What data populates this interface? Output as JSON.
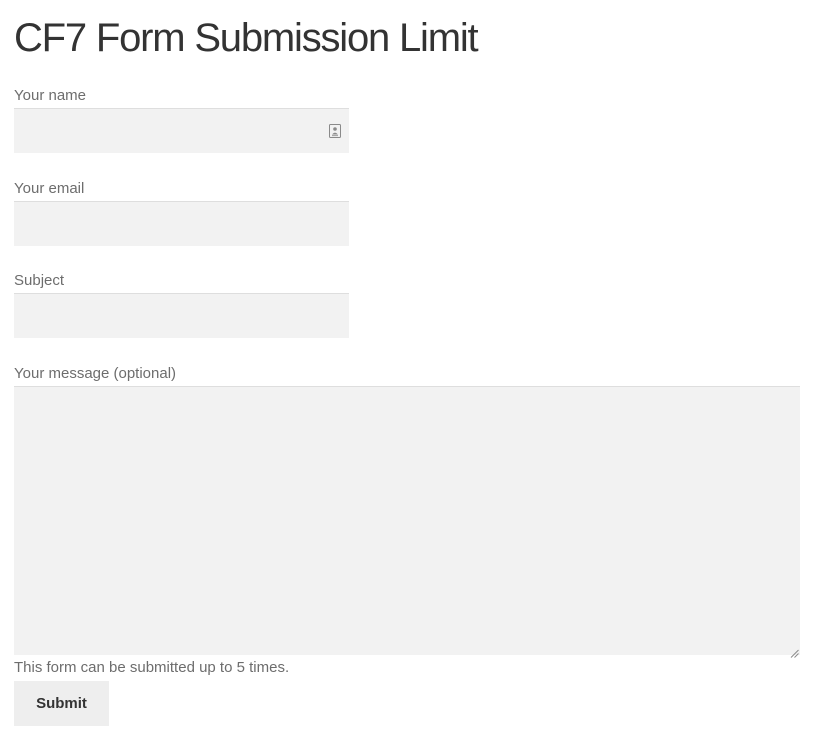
{
  "page": {
    "title": "CF7 Form Submission Limit"
  },
  "form": {
    "fields": [
      {
        "label": "Your name",
        "value": "",
        "placeholder": "",
        "icon": "contact-card-autofill-icon"
      },
      {
        "label": "Your email",
        "value": "",
        "placeholder": ""
      },
      {
        "label": "Subject",
        "value": "",
        "placeholder": ""
      }
    ],
    "message": {
      "label": "Your message (optional)",
      "value": "",
      "placeholder": ""
    },
    "limit_note": "This form can be submitted up to 5 times.",
    "submit_label": "Submit"
  },
  "colors": {
    "input_background": "#f2f2f2",
    "input_border_top": "#dedede",
    "label_text": "#6d6d6d",
    "title_text": "#333333",
    "button_background": "#eeeeee"
  }
}
